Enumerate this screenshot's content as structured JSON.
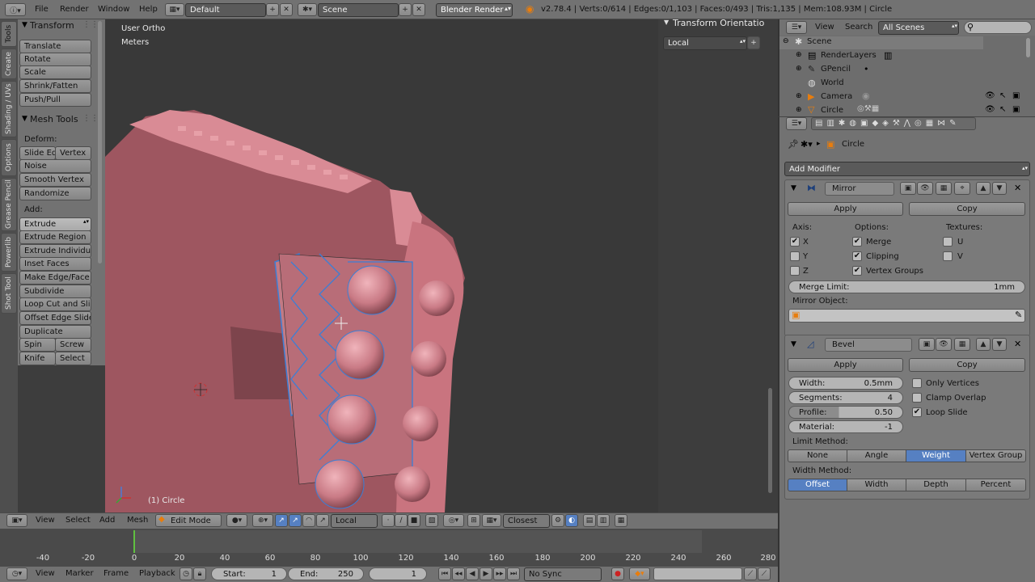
{
  "topbar": {
    "menus": [
      "File",
      "Render",
      "Window",
      "Help"
    ],
    "layout": "Default",
    "scene": "Scene",
    "engine": "Blender Render",
    "stats": "v2.78.4 | Verts:0/614 | Edges:0/1,103 | Faces:0/493 | Tris:1,135 | Mem:108.93M | Circle"
  },
  "tool_tabs": [
    "Tools",
    "Create",
    "Shading / UVs",
    "Options",
    "Grease Pencil",
    "Powerlib",
    "Shot Tool"
  ],
  "toolshelf": {
    "transform_title": "Transform",
    "transform": [
      "Translate",
      "Rotate",
      "Scale",
      "Shrink/Fatten",
      "Push/Pull"
    ],
    "mesh_tools_title": "Mesh Tools",
    "deform_label": "Deform:",
    "slide_edge": "Slide Ed",
    "vertex": "Vertex",
    "deform": [
      "Noise",
      "Smooth Vertex",
      "Randomize"
    ],
    "add_label": "Add:",
    "extrude": "Extrude",
    "add": [
      "Extrude Region",
      "Extrude Individual",
      "Inset Faces",
      "Make Edge/Face",
      "Subdivide",
      "Loop Cut and Slide",
      "Offset Edge Slide",
      "Duplicate"
    ],
    "spin": "Spin",
    "screw": "Screw",
    "knife": "Knife",
    "select": "Select"
  },
  "viewport": {
    "view_name": "User Ortho",
    "units": "Meters",
    "object_label": "(1) Circle",
    "transform_orientations": "Transform Orientatio",
    "orientation": "Local"
  },
  "view3d_header": {
    "menus": [
      "View",
      "Select",
      "Add",
      "Mesh"
    ],
    "mode": "Edit Mode",
    "orientation": "Local",
    "snap": "Closest"
  },
  "timeline": {
    "ticks": [
      "-40",
      "-20",
      "0",
      "20",
      "40",
      "60",
      "80",
      "100",
      "120",
      "140",
      "160",
      "180",
      "200",
      "220",
      "240",
      "260",
      "280"
    ],
    "menus": [
      "View",
      "Marker",
      "Frame",
      "Playback"
    ],
    "start_label": "Start:",
    "start": "1",
    "end_label": "End:",
    "end": "250",
    "current": "1",
    "sync": "No Sync"
  },
  "outliner": {
    "menus": [
      "View",
      "Search"
    ],
    "filter": "All Scenes",
    "items": [
      "Scene",
      "RenderLayers",
      "GPencil",
      "World",
      "Camera",
      "Circle"
    ]
  },
  "properties": {
    "object": "Circle",
    "add_modifier": "Add Modifier",
    "mirror": {
      "name": "Mirror",
      "apply": "Apply",
      "copy": "Copy",
      "axis_label": "Axis:",
      "options_label": "Options:",
      "textures_label": "Textures:",
      "x": "X",
      "y": "Y",
      "z": "Z",
      "merge": "Merge",
      "clipping": "Clipping",
      "vertex_groups": "Vertex Groups",
      "u": "U",
      "v": "V",
      "merge_limit_label": "Merge Limit:",
      "merge_limit": "1mm",
      "mirror_object_label": "Mirror Object:"
    },
    "bevel": {
      "name": "Bevel",
      "apply": "Apply",
      "copy": "Copy",
      "width_label": "Width:",
      "width": "0.5mm",
      "segments_label": "Segments:",
      "segments": "4",
      "profile_label": "Profile:",
      "profile": "0.50",
      "material_label": "Material:",
      "material": "-1",
      "only_vertices": "Only Vertices",
      "clamp_overlap": "Clamp Overlap",
      "loop_slide": "Loop Slide",
      "limit_method_label": "Limit Method:",
      "limit_methods": [
        "None",
        "Angle",
        "Weight",
        "Vertex Group"
      ],
      "width_method_label": "Width Method:",
      "width_methods": [
        "Offset",
        "Width",
        "Depth",
        "Percent"
      ]
    }
  }
}
